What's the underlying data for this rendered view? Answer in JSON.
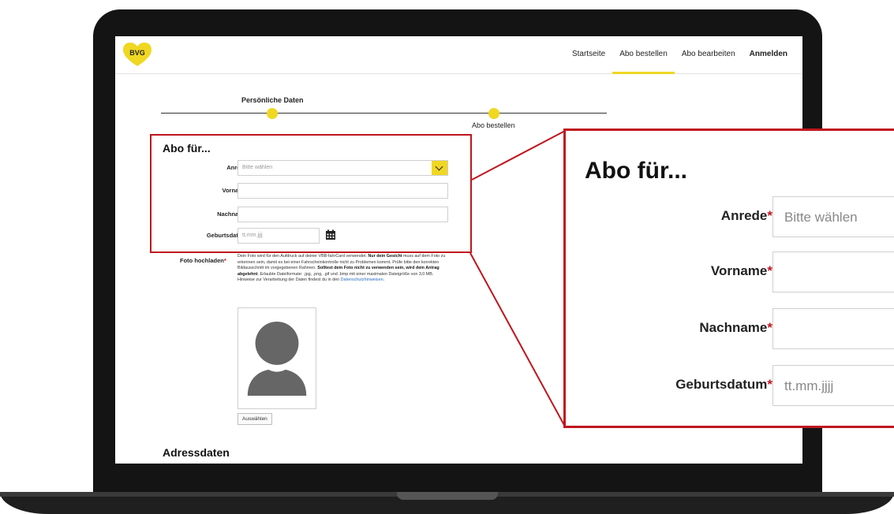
{
  "nav": {
    "logo": "BVG",
    "links": [
      "Startseite",
      "Abo bestellen",
      "Abo bearbeiten",
      "Anmelden"
    ]
  },
  "stepper": {
    "steps": [
      "Persönliche Daten",
      "Abo bestellen"
    ]
  },
  "form": {
    "title": "Abo für...",
    "required_mark": "*",
    "anrede": {
      "label": "Anrede",
      "placeholder": "Bitte wählen"
    },
    "vorname": {
      "label": "Vorname",
      "value": ""
    },
    "nachname": {
      "label": "Nachname",
      "value": ""
    },
    "geburtsdatum": {
      "label": "Geburtsdatum",
      "placeholder": "tt.mm.jjjj"
    }
  },
  "photo": {
    "label": "Foto hochladen",
    "text_1": "Dein Foto wird für den Aufdruck auf deiner VBB-fahrCard verwendet. ",
    "text_bold_1": "Nur dein Gesicht",
    "text_2": " muss auf dem Foto zu erkennen sein, damit es bei einer Fahrscheinkontrolle nicht zu Problemen kommt. Prüfe bitte den korrekten Bildausschnitt im vorgegebenen Rahmen. ",
    "text_bold_2": "Solltest dein Foto nicht zu verwenden sein, wird dein Antrag abgelehnt",
    "text_3": ". Erlaubte Dateiformate: .jpg, .png, .gif und .bmp mit einer maximalen Dateigröße von 3,0 MB. Hinweise zur Verarbeitung der Daten findest du in den ",
    "link": "Datenschutzhinweisen",
    "text_4": ".",
    "button": "Auswählen"
  },
  "address": {
    "title": "Adressdaten"
  },
  "colors": {
    "accent_yellow": "#f0d722",
    "highlight_red": "#c0151e",
    "laptop": "#141414"
  }
}
